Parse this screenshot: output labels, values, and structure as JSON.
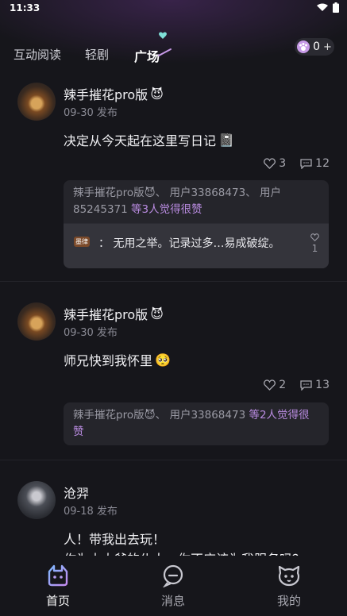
{
  "status": {
    "time": "11:33"
  },
  "tabs": [
    {
      "label": "互动阅读"
    },
    {
      "label": "轻剧"
    },
    {
      "label": "广场"
    }
  ],
  "coins": {
    "count": "0",
    "add": "+"
  },
  "posts": [
    {
      "author": "辣手摧花pro版",
      "date": "09-30 发布",
      "content": "决定从今天起在这里写日记",
      "likes": "3",
      "comments": "12",
      "liked_by_text": "辣手摧花pro版😈、 用户33868473、 用户85245371 ",
      "liked_by_highlight": "等3人觉得很赞",
      "top_comment": {
        "tag": "墨律",
        "text": "： 无用之举。记录过多…易成破绽。",
        "likes": "1"
      }
    },
    {
      "author": "辣手摧花pro版",
      "date": "09-30 发布",
      "content": "师兄快到我怀里",
      "likes": "2",
      "comments": "13",
      "liked_by_text": "辣手摧花pro版😈、 用户33868473 ",
      "liked_by_highlight": "等2人觉得很赞"
    },
    {
      "author": "沧羿",
      "date": "09-18 发布",
      "content_line1": "人！带我出去玩！",
      "content_line2": "作为本大爷的仆人，你不应该为我服务吗？"
    }
  ],
  "bottom_nav": [
    {
      "label": "首页",
      "icon": "home-icon"
    },
    {
      "label": "消息",
      "icon": "message-icon"
    },
    {
      "label": "我的",
      "icon": "profile-icon"
    }
  ],
  "colors": {
    "accent": "#b98be0",
    "background": "#16161b"
  }
}
